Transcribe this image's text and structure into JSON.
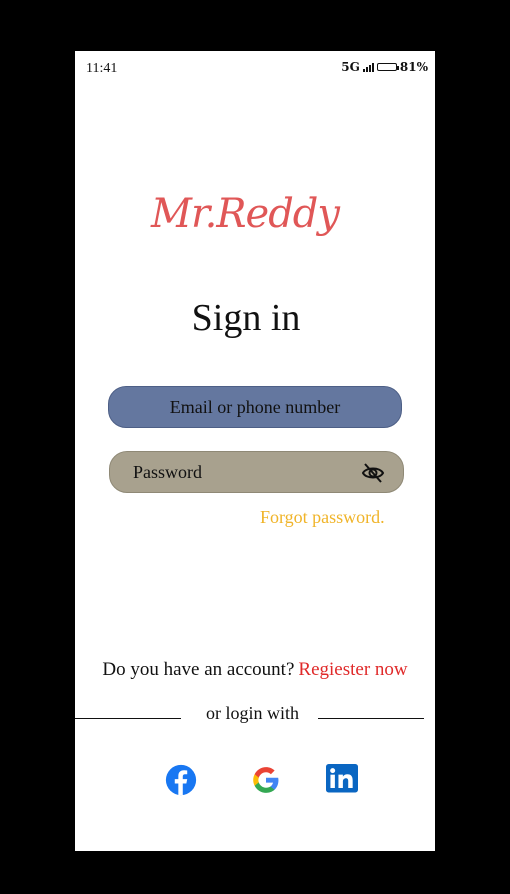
{
  "status_bar": {
    "time": "11:41",
    "network": "5G",
    "battery": "81%",
    "battery_level": 0.81
  },
  "logo": {
    "text": "Mr.Reddy"
  },
  "title": "Sign in",
  "email": {
    "placeholder": "Email or phone number"
  },
  "password": {
    "placeholder": "Password"
  },
  "forgot_label": "Forgot password.",
  "account": {
    "question": "Do you have an account?",
    "register_label": "Regiester now"
  },
  "or_login": "or login with",
  "social": [
    "facebook-icon",
    "google-icon",
    "linkedin-icon"
  ],
  "colors": {
    "logo": "#e05757",
    "email_field": "#64779f",
    "password_field": "#a8a18e",
    "forgot": "#f0b429",
    "register": "#e02a2a",
    "facebook": "#1877f2",
    "linkedin": "#0a66c2"
  }
}
